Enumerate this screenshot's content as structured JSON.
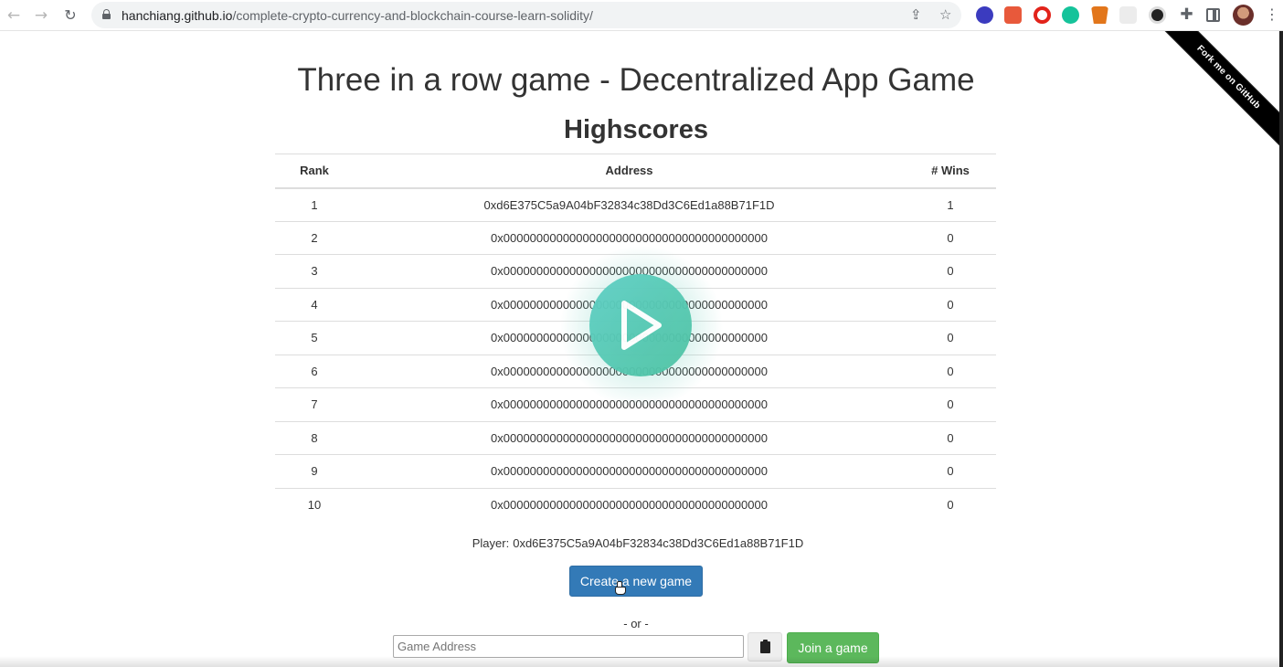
{
  "browser": {
    "url_host": "hanchiang.github.io",
    "url_path": "/complete-crypto-currency-and-blockchain-course-learn-solidity/",
    "back_glyph": "←",
    "forward_glyph": "→",
    "reload_glyph": "↻",
    "share_glyph": "⇪",
    "star_glyph": "☆",
    "extensions_glyph": "✚",
    "menu_glyph": "⋮"
  },
  "ribbon": {
    "label": "Fork me on GitHub"
  },
  "page": {
    "title": "Three in a row game - Decentralized App Game",
    "highscores_heading": "Highscores"
  },
  "table": {
    "headers": {
      "rank": "Rank",
      "address": "Address",
      "wins": "# Wins"
    },
    "rows": [
      {
        "rank": "1",
        "address": "0xd6E375C5a9A04bF32834c38Dd3C6Ed1a88B71F1D",
        "wins": "1"
      },
      {
        "rank": "2",
        "address": "0x0000000000000000000000000000000000000000",
        "wins": "0"
      },
      {
        "rank": "3",
        "address": "0x0000000000000000000000000000000000000000",
        "wins": "0"
      },
      {
        "rank": "4",
        "address": "0x0000000000000000000000000000000000000000",
        "wins": "0"
      },
      {
        "rank": "5",
        "address": "0x0000000000000000000000000000000000000000",
        "wins": "0"
      },
      {
        "rank": "6",
        "address": "0x0000000000000000000000000000000000000000",
        "wins": "0"
      },
      {
        "rank": "7",
        "address": "0x0000000000000000000000000000000000000000",
        "wins": "0"
      },
      {
        "rank": "8",
        "address": "0x0000000000000000000000000000000000000000",
        "wins": "0"
      },
      {
        "rank": "9",
        "address": "0x0000000000000000000000000000000000000000",
        "wins": "0"
      },
      {
        "rank": "10",
        "address": "0x0000000000000000000000000000000000000000",
        "wins": "0"
      }
    ]
  },
  "player": {
    "label": "Player:",
    "address": "0xd6E375C5a9A04bF32834c38Dd3C6Ed1a88B71F1D"
  },
  "actions": {
    "create_label": "Create a new game",
    "or_label": "- or -",
    "game_address_placeholder": "Game Address",
    "join_label": "Join a game"
  },
  "colors": {
    "create_button": "#337ab7",
    "join_button": "#5cb85c",
    "play_overlay": "#56c9b4"
  }
}
